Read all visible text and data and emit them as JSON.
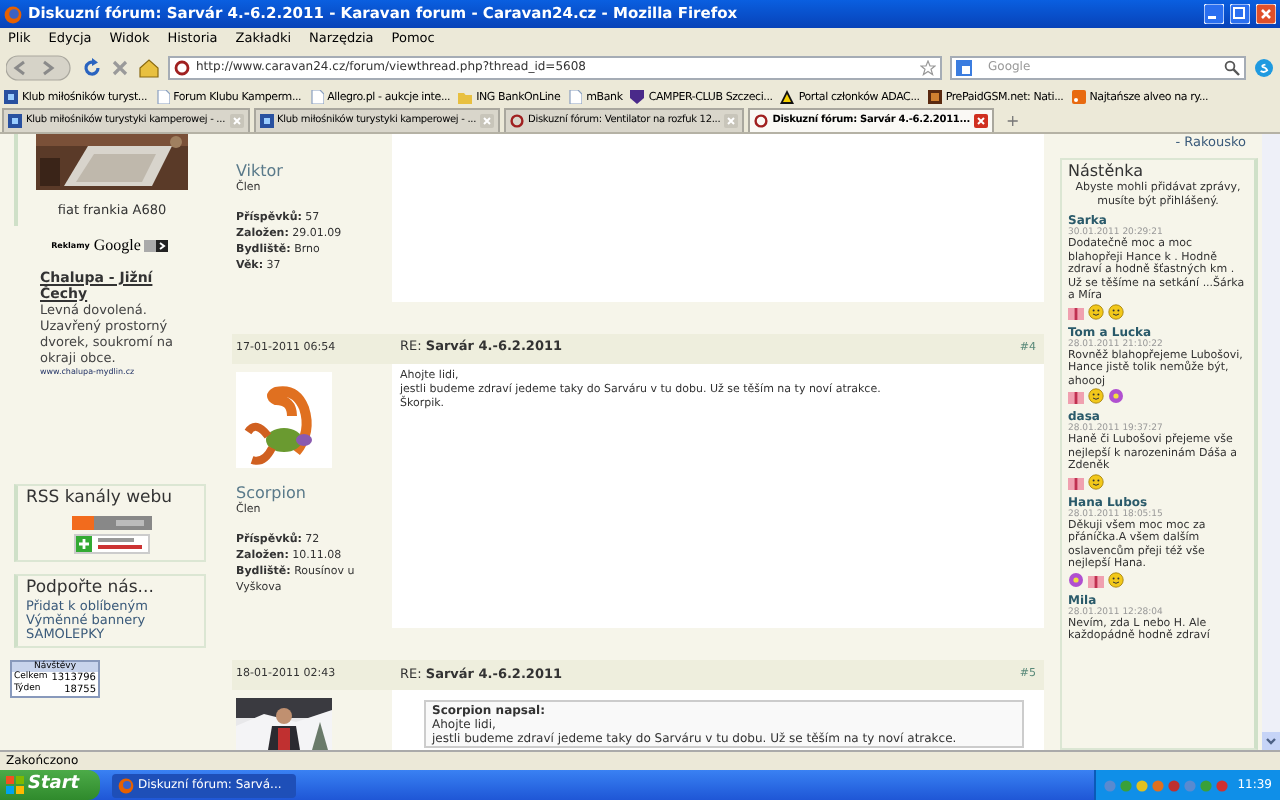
{
  "window": {
    "title": "Diskuzní fórum: Sarvár 4.-6.2.2011 - Karavan forum - Caravan24.cz - Mozilla Firefox"
  },
  "menu": [
    "Plik",
    "Edycja",
    "Widok",
    "Historia",
    "Zakładki",
    "Narzędzia",
    "Pomoc"
  ],
  "address": {
    "value": "http://www.caravan24.cz/forum/viewthread.php?thread_id=5608"
  },
  "search": {
    "placeholder": "Google"
  },
  "bookmarks": [
    {
      "label": "Klub miłośników turyst...",
      "kind": "site"
    },
    {
      "label": "Forum Klubu Kamperm...",
      "kind": "page"
    },
    {
      "label": "Allegro.pl - aukcje inte...",
      "kind": "page"
    },
    {
      "label": "ING BankOnLine",
      "kind": "folder"
    },
    {
      "label": "mBank",
      "kind": "page"
    },
    {
      "label": "CAMPER-CLUB Szczeci...",
      "kind": "shield"
    },
    {
      "label": "Portal członków ADAC...",
      "kind": "adac"
    },
    {
      "label": "PrePaidGSM.net: Nati...",
      "kind": "dark"
    },
    {
      "label": "Najtańsze alveo na ry...",
      "kind": "feed"
    }
  ],
  "tabs": [
    {
      "label": "Klub miłośników turystyki kamperowej - ...",
      "selected": false,
      "kind": "site"
    },
    {
      "label": "Klub miłośników turystyki kamperowej - ...",
      "selected": false,
      "kind": "site"
    },
    {
      "label": "Diskuzní fórum: Ventilator na rozfuk 12...",
      "selected": false,
      "kind": "c"
    },
    {
      "label": "Diskuzní fórum: Sarvár 4.-6.2.2011...",
      "selected": true,
      "kind": "c"
    }
  ],
  "new_tab": "+",
  "left_sidebar": {
    "photo_caption": "fiat frankia A680",
    "ads_label": "Reklamy",
    "ads_brand": "Google",
    "ad": {
      "title": "Chalupa - Jižní Čechy",
      "text": "Levná dovolená. Uzavřený prostorný dvorek, soukromí na okraji obce.",
      "url": "www.chalupa-mydlin.cz"
    },
    "rss": {
      "title": "RSS kanály webu"
    },
    "support": {
      "title": "Podpořte nás...",
      "links": [
        "Přidat k oblíbeným",
        "Výměnné bannery",
        "SAMOLEPKY"
      ]
    },
    "stats": {
      "title": "Návštěvy",
      "rows": [
        {
          "label": "Celkem",
          "value": "1313796"
        },
        {
          "label": "Týden",
          "value": "18755"
        }
      ]
    }
  },
  "posts": [
    {
      "author": "Viktor",
      "rank": "Člen",
      "stats": [
        {
          "label": "Příspěvků:",
          "value": "57"
        },
        {
          "label": "Založen:",
          "value": "29.01.09"
        },
        {
          "label": "Bydliště:",
          "value": "Brno"
        },
        {
          "label": "Věk:",
          "value": "37"
        }
      ]
    },
    {
      "date": "17-01-2011 06:54",
      "title": "RE: **Sarvár 4.-6.2.2011**",
      "number": "#4",
      "avatar": {
        "kind": "scorpion"
      },
      "body": [
        "Ahojte lidi,",
        "jestli budeme zdraví jedeme taky do Sarváru v tu dobu. Už se těším na ty noví atrakce.",
        "Škorpik."
      ],
      "author": "Scorpion",
      "rank": "Člen",
      "stats": [
        {
          "label": "Příspěvků:",
          "value": "72"
        },
        {
          "label": "Založen:",
          "value": "10.11.08"
        },
        {
          "label": "Bydliště:",
          "value": "Rousínov u Vyškova"
        }
      ]
    },
    {
      "date": "18-01-2011 02:43",
      "title": "RE: **Sarvár 4.-6.2.2011**",
      "number": "#5",
      "quote": {
        "author": "Scorpion napsal:",
        "lines": [
          "Ahojte lidi,",
          "jestli budeme zdraví jedeme taky do Sarváru v tu dobu. Už se těším na ty noví atrakce."
        ]
      }
    }
  ],
  "right_sidebar": {
    "top_link": "- Rakousko",
    "title": "Nástěnka",
    "notice": "Abyste mohli přidávat zprávy, musíte být přihlášený.",
    "messages": [
      {
        "author": "Sarka",
        "time": "30.01.2011 20:29:21",
        "text": "Dodatečně moc a moc blahopřeji Hance k . Hodně zdraví a hodně šťastných km . Už se těšíme na setkání ...Šárka a Míra",
        "emoticons": [
          {
            "kind": "gift"
          },
          {
            "kind": "smiley"
          },
          {
            "kind": "smiley"
          }
        ]
      },
      {
        "author": "Tom a Lucka",
        "time": "28.01.2011 21:10:22",
        "text": "Rovněž blahopřejeme Lubošovi, Hance jistě tolik nemůže být, ahoooj",
        "emoticons": [
          {
            "kind": "gift"
          },
          {
            "kind": "smiley"
          },
          {
            "kind": "flower"
          }
        ]
      },
      {
        "author": "dasa",
        "time": "28.01.2011 19:37:27",
        "text": "Haně či Lubošovi přejeme vše nejlepší k narozeninám  Dáša a Zdeněk",
        "emoticons": [
          {
            "kind": "gift"
          },
          {
            "kind": "smiley"
          }
        ]
      },
      {
        "author": "Hana Lubos",
        "time": "28.01.2011 18:05:15",
        "text": "Děkuji všem moc moc za přáníčka.A všem dalším oslavencům přeji též vše nejlepší Hana.",
        "emoticons": [
          {
            "kind": "flower"
          },
          {
            "kind": "gift"
          },
          {
            "kind": "smiley"
          }
        ]
      },
      {
        "author": "Mila",
        "time": "28.01.2011 12:28:04",
        "text": "Nevím, zda L nebo H. Ale každopádně hodně zdraví"
      }
    ]
  },
  "status_bar": {
    "text": "Zakończono"
  },
  "taskbar": {
    "start": "Start",
    "tasks": [
      {
        "label": "Diskuzní fórum: Sarvá...",
        "selected": true
      }
    ],
    "clock": "11:39"
  }
}
